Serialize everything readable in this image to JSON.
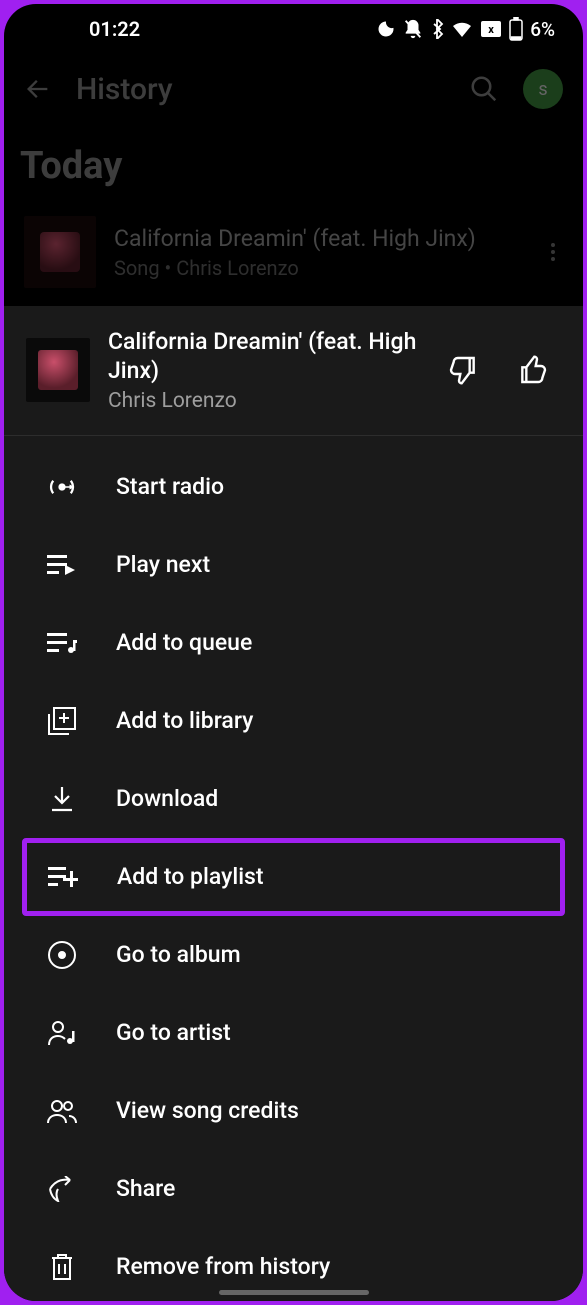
{
  "status": {
    "time": "01:22",
    "battery_pct": "6%"
  },
  "appbar": {
    "title": "History",
    "avatar_letter": "s"
  },
  "section_heading": "Today",
  "history_item": {
    "title": "California Dreamin' (feat. High Jinx)",
    "subtitle": "Song • Chris Lorenzo"
  },
  "sheet": {
    "title": "California Dreamin' (feat. High Jinx)",
    "artist": "Chris Lorenzo"
  },
  "menu": {
    "start_radio": "Start radio",
    "play_next": "Play next",
    "add_queue": "Add to queue",
    "add_library": "Add to library",
    "download": "Download",
    "add_playlist": "Add to playlist",
    "go_album": "Go to album",
    "go_artist": "Go to artist",
    "view_credits": "View song credits",
    "share": "Share",
    "remove_history": "Remove from history"
  },
  "highlight_color": "#a020f0"
}
